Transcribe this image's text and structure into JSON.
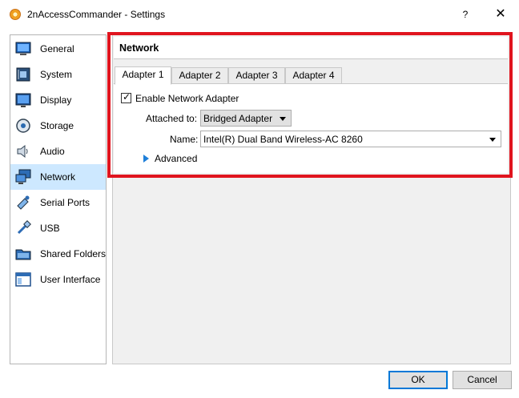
{
  "window": {
    "title": "2nAccessCommander - Settings",
    "help_label": "?",
    "close_label": "✕"
  },
  "sidebar": {
    "items": [
      {
        "label": "General",
        "icon": "general-icon"
      },
      {
        "label": "System",
        "icon": "system-icon"
      },
      {
        "label": "Display",
        "icon": "display-icon"
      },
      {
        "label": "Storage",
        "icon": "storage-icon"
      },
      {
        "label": "Audio",
        "icon": "audio-icon"
      },
      {
        "label": "Network",
        "icon": "network-icon",
        "selected": true
      },
      {
        "label": "Serial Ports",
        "icon": "serial-ports-icon"
      },
      {
        "label": "USB",
        "icon": "usb-icon"
      },
      {
        "label": "Shared Folders",
        "icon": "shared-folders-icon"
      },
      {
        "label": "User Interface",
        "icon": "user-interface-icon"
      }
    ]
  },
  "main": {
    "section_title": "Network",
    "tabs": [
      {
        "label": "Adapter 1",
        "active": true
      },
      {
        "label": "Adapter 2"
      },
      {
        "label": "Adapter 3"
      },
      {
        "label": "Adapter 4"
      }
    ],
    "enable_adapter": {
      "label": "Enable Network Adapter",
      "checked": true,
      "mark": "✓"
    },
    "attached_to": {
      "label": "Attached to:",
      "value": "Bridged Adapter"
    },
    "name": {
      "label": "Name:",
      "value": "Intel(R) Dual Band Wireless-AC 8260"
    },
    "advanced_label": "Advanced"
  },
  "buttons": {
    "ok": "OK",
    "cancel": "Cancel"
  },
  "colors": {
    "highlight_border": "#e0141e",
    "selection": "#cde8ff",
    "accent": "#0078d7"
  }
}
